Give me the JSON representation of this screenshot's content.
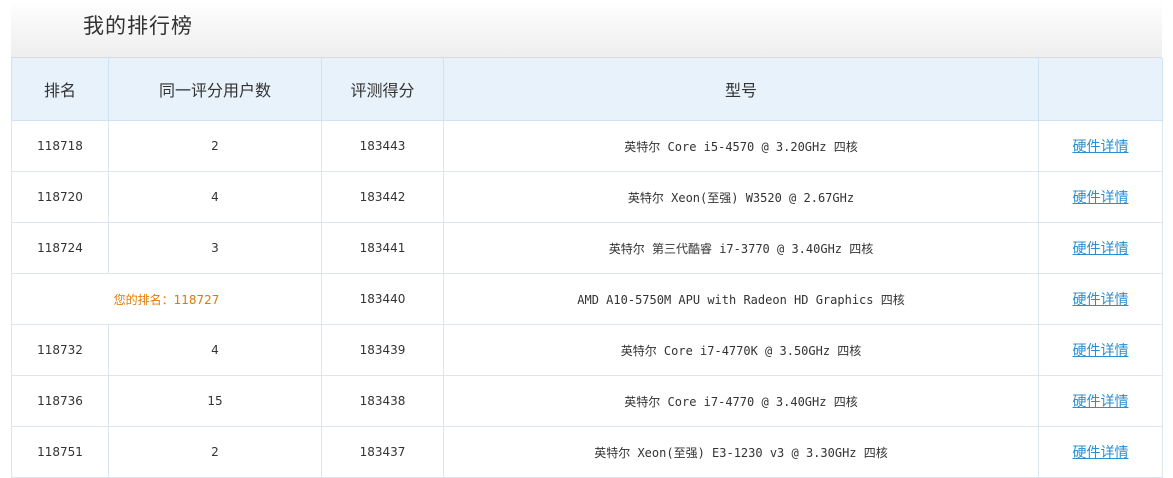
{
  "header": {
    "title": "我的排行榜"
  },
  "columns": [
    "排名",
    "同一评分用户数",
    "评测得分",
    "型号",
    ""
  ],
  "rows": [
    {
      "rank": "118718",
      "same_users": "2",
      "score": "183443",
      "model": "英特尔 Core i5-4570 @ 3.20GHz 四核",
      "link": "硬件详情"
    },
    {
      "rank": "118720",
      "same_users": "4",
      "score": "183442",
      "model": "英特尔 Xeon(至强) W3520 @ 2.67GHz",
      "link": "硬件详情"
    },
    {
      "rank": "118724",
      "same_users": "3",
      "score": "183441",
      "model": "英特尔 第三代酷睿 i7-3770 @ 3.40GHz 四核",
      "link": "硬件详情"
    },
    {
      "your_rank": "您的排名：118727",
      "score": "183440",
      "model": "AMD A10-5750M APU with Radeon HD Graphics 四核",
      "link": "硬件详情"
    },
    {
      "rank": "118732",
      "same_users": "4",
      "score": "183439",
      "model": "英特尔 Core i7-4770K @ 3.50GHz 四核",
      "link": "硬件详情"
    },
    {
      "rank": "118736",
      "same_users": "15",
      "score": "183438",
      "model": "英特尔 Core i7-4770 @ 3.40GHz 四核",
      "link": "硬件详情"
    },
    {
      "rank": "118751",
      "same_users": "2",
      "score": "183437",
      "model": "英特尔 Xeon(至强) E3-1230 v3 @ 3.30GHz 四核",
      "link": "硬件详情"
    }
  ],
  "colors": {
    "header_bg": "#e8f2fb",
    "link": "#2a8ed0",
    "highlight": "#e07b00"
  }
}
